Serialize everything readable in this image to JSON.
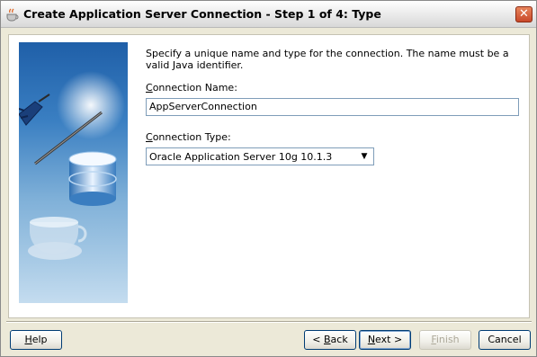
{
  "window": {
    "title": "Create Application Server Connection - Step 1 of 4: Type",
    "close_glyph": "✕"
  },
  "form": {
    "instructions": "Specify a unique name and type for the connection. The name must be a valid Java identifier.",
    "connection_name": {
      "label_mnemonic": "C",
      "label_rest": "onnection Name:",
      "value": "AppServerConnection"
    },
    "connection_type": {
      "label_mnemonic": "C",
      "label_rest": "onnection Type:",
      "selected": "Oracle Application Server 10g 10.1.3"
    }
  },
  "buttons": {
    "help": {
      "mnemonic": "H",
      "rest": "elp"
    },
    "back": {
      "prefix": "< ",
      "mnemonic": "B",
      "rest": "ack"
    },
    "next": {
      "mnemonic": "N",
      "rest": "ext >"
    },
    "finish": {
      "mnemonic": "F",
      "rest": "inish"
    },
    "cancel": "Cancel"
  },
  "icons": {
    "title": "coffee-cup-icon",
    "dropdown": "chevron-down-icon",
    "side_image": "wizard-database-graphic"
  },
  "colors": {
    "title_text": "#000000",
    "close_button": "#c8482a",
    "input_border": "#7f9db9",
    "button_border": "#003c74",
    "disabled_text": "#aca899"
  }
}
